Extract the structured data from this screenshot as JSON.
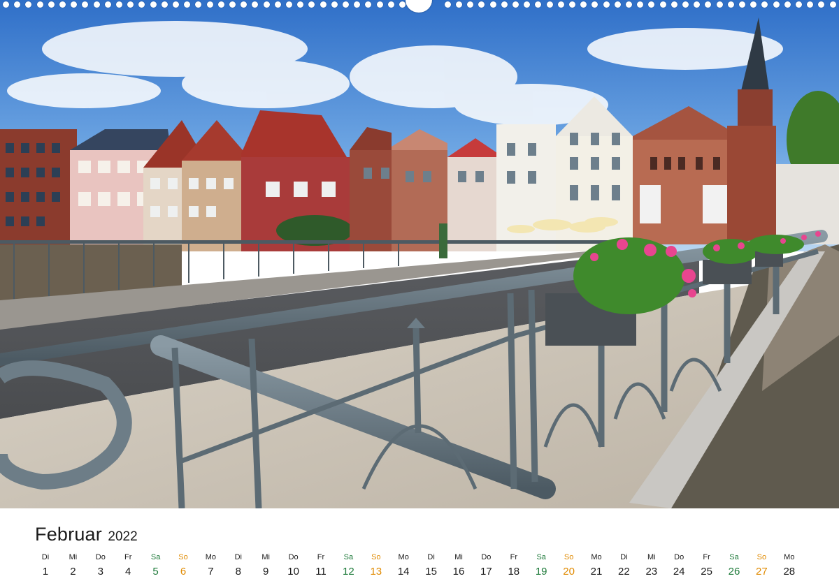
{
  "photo": {
    "description_icon": "photo-bridge-riverside-town-icon",
    "colors": {
      "sky_top": "#3c7fd4",
      "sky_bottom": "#a9cdf0",
      "railing": "#5d6d78",
      "road": "#55575a",
      "brick": "#8e3a2b",
      "flowers": "#e8458f",
      "leaves": "#3f8a2c"
    }
  },
  "calendar": {
    "month": "Februar",
    "year": "2022",
    "colors": {
      "saturday": "#1e7a3a",
      "sunday": "#e08a00",
      "weekday": "#1a1a1a"
    },
    "days": [
      {
        "wd": "Di",
        "d": "1",
        "type": "weekday"
      },
      {
        "wd": "Mi",
        "d": "2",
        "type": "weekday"
      },
      {
        "wd": "Do",
        "d": "3",
        "type": "weekday"
      },
      {
        "wd": "Fr",
        "d": "4",
        "type": "weekday"
      },
      {
        "wd": "Sa",
        "d": "5",
        "type": "sat"
      },
      {
        "wd": "So",
        "d": "6",
        "type": "sun"
      },
      {
        "wd": "Mo",
        "d": "7",
        "type": "weekday"
      },
      {
        "wd": "Di",
        "d": "8",
        "type": "weekday"
      },
      {
        "wd": "Mi",
        "d": "9",
        "type": "weekday"
      },
      {
        "wd": "Do",
        "d": "10",
        "type": "weekday"
      },
      {
        "wd": "Fr",
        "d": "11",
        "type": "weekday"
      },
      {
        "wd": "Sa",
        "d": "12",
        "type": "sat"
      },
      {
        "wd": "So",
        "d": "13",
        "type": "sun"
      },
      {
        "wd": "Mo",
        "d": "14",
        "type": "weekday"
      },
      {
        "wd": "Di",
        "d": "15",
        "type": "weekday"
      },
      {
        "wd": "Mi",
        "d": "16",
        "type": "weekday"
      },
      {
        "wd": "Do",
        "d": "17",
        "type": "weekday"
      },
      {
        "wd": "Fr",
        "d": "18",
        "type": "weekday"
      },
      {
        "wd": "Sa",
        "d": "19",
        "type": "sat"
      },
      {
        "wd": "So",
        "d": "20",
        "type": "sun"
      },
      {
        "wd": "Mo",
        "d": "21",
        "type": "weekday"
      },
      {
        "wd": "Di",
        "d": "22",
        "type": "weekday"
      },
      {
        "wd": "Mi",
        "d": "23",
        "type": "weekday"
      },
      {
        "wd": "Do",
        "d": "24",
        "type": "weekday"
      },
      {
        "wd": "Fr",
        "d": "25",
        "type": "weekday"
      },
      {
        "wd": "Sa",
        "d": "26",
        "type": "sat"
      },
      {
        "wd": "So",
        "d": "27",
        "type": "sun"
      },
      {
        "wd": "Mo",
        "d": "28",
        "type": "weekday"
      }
    ]
  }
}
